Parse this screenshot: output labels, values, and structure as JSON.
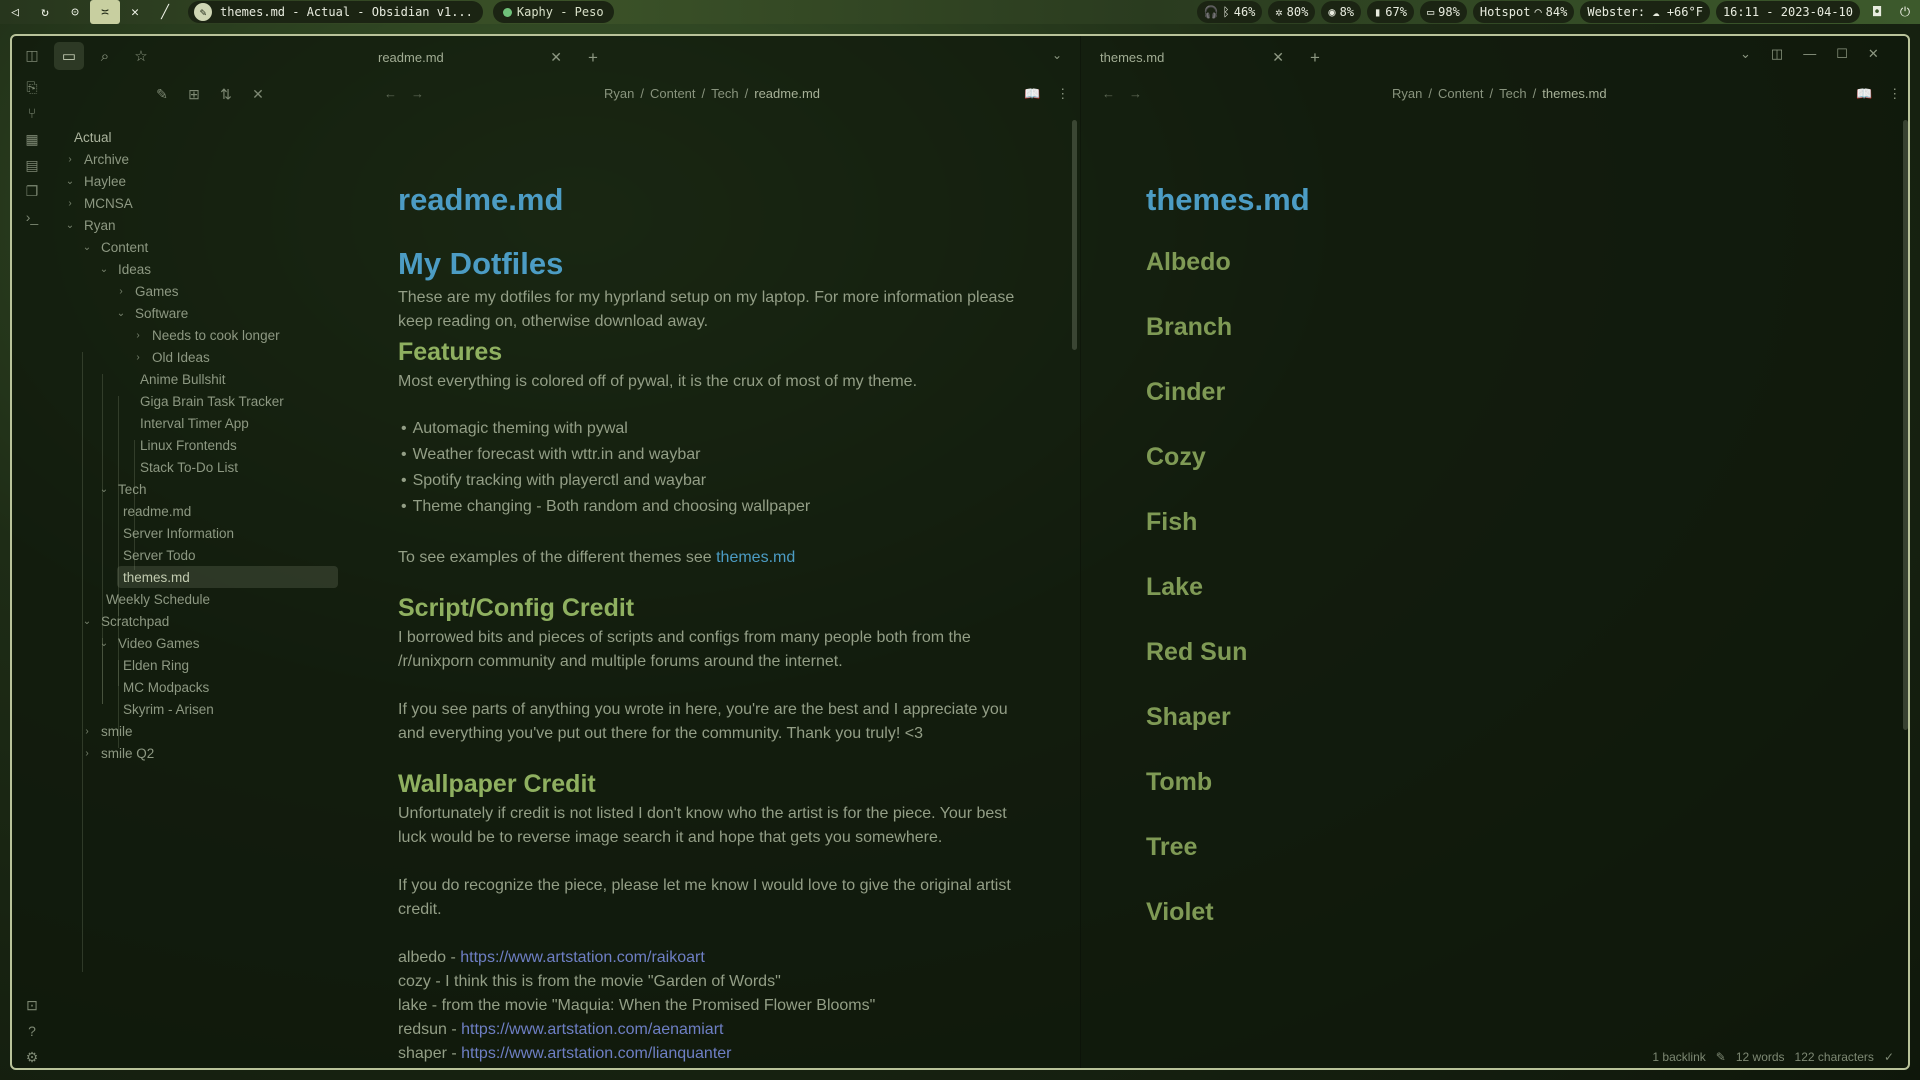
{
  "topbar": {
    "workspaces": [
      "◁",
      "↻",
      "⊝",
      "≍",
      "✕",
      "╱"
    ],
    "active_window_title": "themes.md - Actual - Obsidian v1...",
    "music": "Kaphy - Peso",
    "stats": {
      "volume": "46%",
      "fan": "80%",
      "cpu": "8%",
      "battery_bar": "67%",
      "battery": "98%",
      "network": "Hotspot",
      "wifi": "84%",
      "weather": "Webster: ☁ +66°F",
      "datetime": "16:11 - 2023-04-10"
    }
  },
  "sidebar": {
    "root": "Actual",
    "items": [
      {
        "label": "Archive",
        "depth": 0,
        "chevron": "›"
      },
      {
        "label": "Haylee",
        "depth": 0,
        "chevron": "⌄"
      },
      {
        "label": "MCNSA",
        "depth": 0,
        "chevron": "›"
      },
      {
        "label": "Ryan",
        "depth": 0,
        "chevron": "⌄"
      },
      {
        "label": "Content",
        "depth": 1,
        "chevron": "⌄"
      },
      {
        "label": "Ideas",
        "depth": 2,
        "chevron": "⌄"
      },
      {
        "label": "Games",
        "depth": 3,
        "chevron": "›"
      },
      {
        "label": "Software",
        "depth": 3,
        "chevron": "⌄"
      },
      {
        "label": "Needs to cook longer",
        "depth": 4,
        "chevron": "›"
      },
      {
        "label": "Old Ideas",
        "depth": 4,
        "chevron": "›"
      },
      {
        "label": "Anime Bullshit",
        "depth": 4,
        "chevron": ""
      },
      {
        "label": "Giga Brain Task Tracker",
        "depth": 4,
        "chevron": ""
      },
      {
        "label": "Interval Timer App",
        "depth": 4,
        "chevron": ""
      },
      {
        "label": "Linux Frontends",
        "depth": 4,
        "chevron": ""
      },
      {
        "label": "Stack To-Do List",
        "depth": 4,
        "chevron": ""
      },
      {
        "label": "Tech",
        "depth": 2,
        "chevron": "⌄"
      },
      {
        "label": "readme.md",
        "depth": 3,
        "chevron": ""
      },
      {
        "label": "Server Information",
        "depth": 3,
        "chevron": ""
      },
      {
        "label": "Server Todo",
        "depth": 3,
        "chevron": ""
      },
      {
        "label": "themes.md",
        "depth": 3,
        "chevron": "",
        "selected": true
      },
      {
        "label": "Weekly Schedule",
        "depth": 2,
        "chevron": ""
      },
      {
        "label": "Scratchpad",
        "depth": 1,
        "chevron": "⌄"
      },
      {
        "label": "Video Games",
        "depth": 2,
        "chevron": "⌄"
      },
      {
        "label": "Elden Ring",
        "depth": 3,
        "chevron": ""
      },
      {
        "label": "MC Modpacks",
        "depth": 3,
        "chevron": ""
      },
      {
        "label": "Skyrim - Arisen",
        "depth": 3,
        "chevron": ""
      },
      {
        "label": "smile",
        "depth": 1,
        "chevron": "›"
      },
      {
        "label": "smile Q2",
        "depth": 1,
        "chevron": "›"
      }
    ]
  },
  "pane1": {
    "tab": "readme.md",
    "breadcrumb": [
      "Ryan",
      "Content",
      "Tech",
      "readme.md"
    ],
    "title": "readme.md",
    "h1": "My Dotfiles",
    "intro": "These are my dotfiles for my hyprland setup on my laptop. For more information please keep reading on, otherwise download away.",
    "features_h": "Features",
    "features_p": "Most everything is colored off of pywal, it is the crux of most of my theme.",
    "features_list": [
      "Automagic theming with pywal",
      "Weather forecast with wttr.in and waybar",
      "Spotify tracking with playerctl and waybar",
      "Theme changing - Both random and choosing wallpaper"
    ],
    "themes_line": "To see examples of the different themes see ",
    "themes_link": "themes.md",
    "script_h": "Script/Config Credit",
    "script_p1": "I borrowed bits and pieces of scripts and configs from many people both from the /r/unixporn community and multiple forums around the internet.",
    "script_p2": "If you see parts of anything you wrote in here, you're are the best and I appreciate you and everything you've put out there for the community. Thank you truly! <3",
    "wallpaper_h": "Wallpaper Credit",
    "wallpaper_p1": "Unfortunately if credit is not listed I don't know who the artist is for the piece. Your best luck would be to reverse image search it and hope that gets you somewhere.",
    "wallpaper_p2": "If you do recognize the piece, please let me know I would love to give the original artist credit.",
    "credits": [
      {
        "prefix": "albedo - ",
        "link": "https://www.artstation.com/raikoart"
      },
      {
        "prefix": "cozy - I think this is from the movie \"Garden of Words\"",
        "link": ""
      },
      {
        "prefix": "lake - from the movie \"Maquia: When the Promised Flower Blooms\"",
        "link": ""
      },
      {
        "prefix": "redsun - ",
        "link": "https://www.artstation.com/aenamiart"
      },
      {
        "prefix": "shaper - ",
        "link": "https://www.artstation.com/lianquanter"
      }
    ]
  },
  "pane2": {
    "tab": "themes.md",
    "breadcrumb": [
      "Ryan",
      "Content",
      "Tech",
      "themes.md"
    ],
    "title": "themes.md",
    "themes": [
      "Albedo",
      "Branch",
      "Cinder",
      "Cozy",
      "Fish",
      "Lake",
      "Red Sun",
      "Shaper",
      "Tomb",
      "Tree",
      "Violet"
    ]
  },
  "status": {
    "backlinks": "1 backlink",
    "words": "12 words",
    "characters": "122 characters"
  },
  "colors": {
    "link": "#4c9cc4",
    "heading2": "#8fb060",
    "external_link": "#6e7fc4",
    "border": "#b9c39a"
  }
}
